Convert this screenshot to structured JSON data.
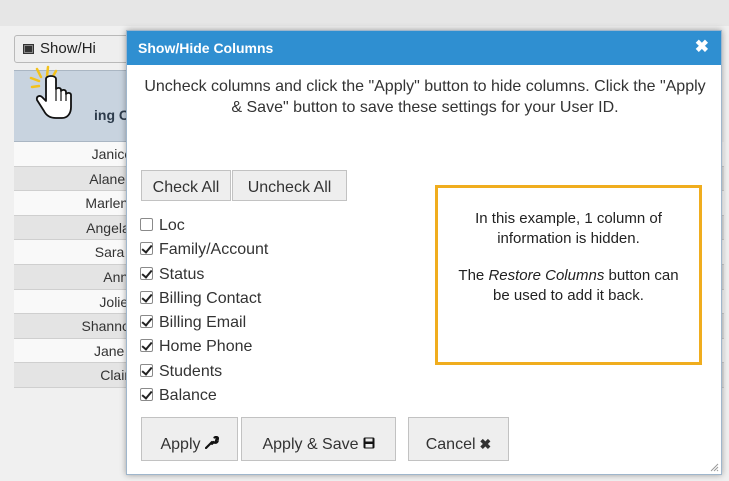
{
  "background": {
    "show_hide_button_label": "Show/Hi",
    "header_label": "ing Co",
    "rows": [
      "Janice Br",
      "Alane Cle",
      "Marlene D",
      "Angela Fo",
      "Sara Gol",
      "Anna H",
      "Jolie Hu",
      "Shannon Ir",
      "Jane Jac",
      "Claire K"
    ]
  },
  "dialog": {
    "title": "Show/Hide Columns",
    "close_icon": "close-icon",
    "intro": "Uncheck columns and click the \"Apply\" button to hide columns. Click the \"Apply & Save\" button to save these settings for your User ID.",
    "check_all_label": "Check All",
    "uncheck_all_label": "Uncheck All",
    "columns": [
      {
        "label": "Loc",
        "checked": false
      },
      {
        "label": "Family/Account",
        "checked": true
      },
      {
        "label": "Status",
        "checked": true
      },
      {
        "label": "Billing Contact",
        "checked": true
      },
      {
        "label": "Billing Email",
        "checked": true
      },
      {
        "label": "Home Phone",
        "checked": true
      },
      {
        "label": "Students",
        "checked": true
      },
      {
        "label": "Balance",
        "checked": true
      }
    ],
    "apply_label": "Apply",
    "apply_save_label": "Apply & Save",
    "cancel_label": "Cancel"
  },
  "callout": {
    "line1": "In this example, 1 column of information is hidden.",
    "line2_prefix": "The ",
    "line2_emphasis": "Restore Columns",
    "line2_suffix": " button can be used to add it back."
  },
  "colors": {
    "title_bar": "#2f8fd1",
    "callout_border": "#f0ad1e",
    "header_bg": "#c8d3df"
  }
}
